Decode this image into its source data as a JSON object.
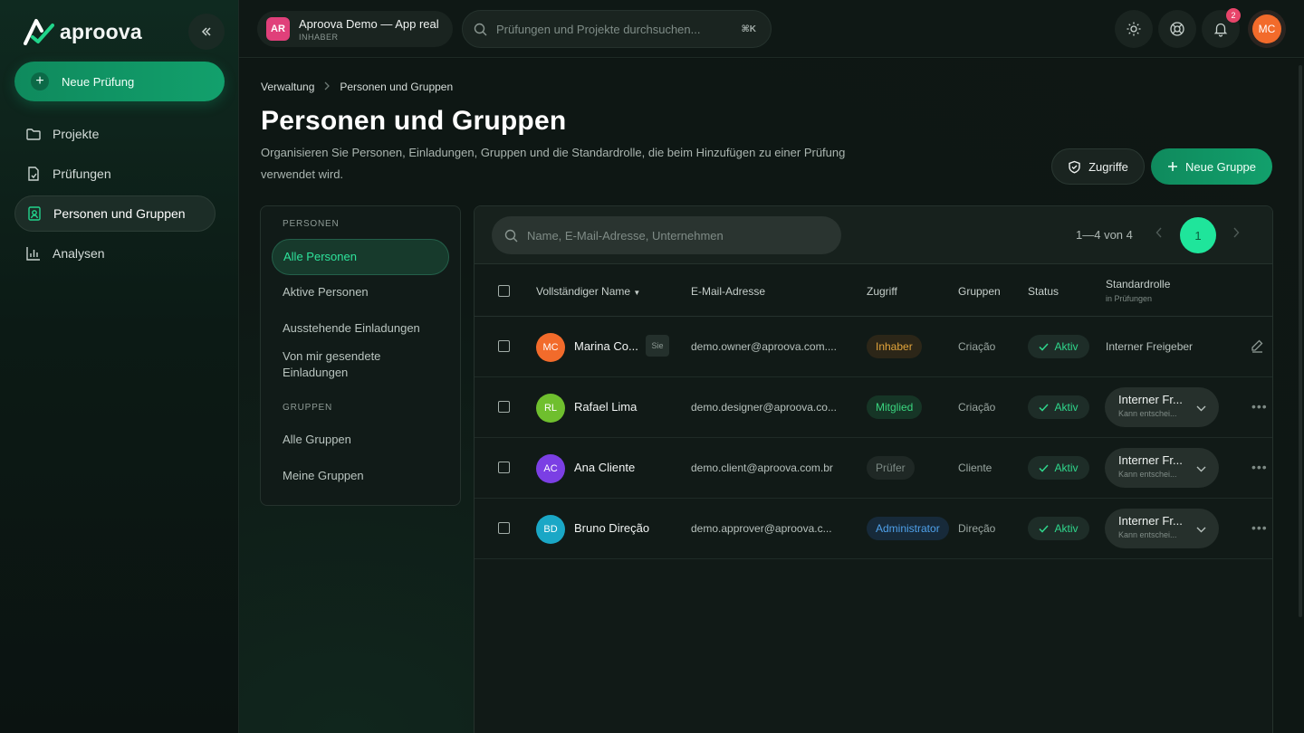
{
  "colors": {
    "accent": "#1fe59b",
    "brand_green": "#12a06c",
    "owner": "#e2a43b",
    "admin": "#4fa1ea"
  },
  "sidebar": {
    "brand": "aproova",
    "collapse_icon": "chevrons-left-icon",
    "new_exam_label": "Neue Prüfung",
    "items": [
      {
        "label": "Projekte",
        "icon": "folder-icon",
        "active": false
      },
      {
        "label": "Prüfungen",
        "icon": "file-check-icon",
        "active": false
      },
      {
        "label": "Personen und Gruppen",
        "icon": "contact-card-icon",
        "active": true
      },
      {
        "label": "Analysen",
        "icon": "bar-chart-icon",
        "active": false
      }
    ]
  },
  "topbar": {
    "workspace_initials": "AR",
    "workspace_name": "Aproova Demo — App real",
    "workspace_role": "INHABER",
    "search_placeholder": "Prüfungen und Projekte durchsuchen...",
    "search_shortcut": "⌘K",
    "notification_count": "2",
    "user_initials": "MC"
  },
  "page": {
    "breadcrumb": [
      "Verwaltung",
      "Personen und Gruppen"
    ],
    "title": "Personen und Gruppen",
    "description": "Organisieren Sie Personen, Einladungen, Gruppen und die Standardrolle, die beim Hinzufügen zu einer Prüfung verwendet wird.",
    "access_button": "Zugriffe",
    "new_group_button": "Neue Gruppe"
  },
  "filters": {
    "people_section": "PERSONEN",
    "people": [
      "Alle Personen",
      "Aktive Personen",
      "Ausstehende Einladungen",
      "Von mir gesendete Einladungen"
    ],
    "groups_section": "GRUPPEN",
    "groups": [
      "Alle Gruppen",
      "Meine Gruppen"
    ]
  },
  "table": {
    "search_placeholder": "Name, E-Mail-Adresse, Unternehmen",
    "pager_text": "1—4 von 4",
    "current_page": "1",
    "columns": {
      "name": "Vollständiger Name",
      "email": "E-Mail-Adresse",
      "access": "Zugriff",
      "groups": "Gruppen",
      "status": "Status",
      "role": "Standardrolle",
      "role_sub": "in Prüfungen"
    },
    "rows": [
      {
        "initials": "MC",
        "avatar_color": "#f26b2b",
        "name": "Marina Co...",
        "you": "Sie",
        "email": "demo.owner@aproova.com....",
        "access": "Inhaber",
        "access_type": "owner",
        "group": "Criação",
        "status": "Aktiv",
        "role": "Interner Freigeber",
        "role_sub": "",
        "editable": true
      },
      {
        "initials": "RL",
        "avatar_color": "#6fbf2e",
        "name": "Rafael Lima",
        "you": "",
        "email": "demo.designer@aproova.co...",
        "access": "Mitglied",
        "access_type": "member",
        "group": "Criação",
        "status": "Aktiv",
        "role": "Interner Fr...",
        "role_sub": "Kann entschei...",
        "editable": false
      },
      {
        "initials": "AC",
        "avatar_color": "#7b3fe4",
        "name": "Ana Cliente",
        "you": "",
        "email": "demo.client@aproova.com.br",
        "access": "Prüfer",
        "access_type": "reviewer",
        "group": "Cliente",
        "status": "Aktiv",
        "role": "Interner Fr...",
        "role_sub": "Kann entschei...",
        "editable": false
      },
      {
        "initials": "BD",
        "avatar_color": "#1aa7c6",
        "name": "Bruno Direção",
        "you": "",
        "email": "demo.approver@aproova.c...",
        "access": "Administrator",
        "access_type": "admin",
        "group": "Direção",
        "status": "Aktiv",
        "role": "Interner Fr...",
        "role_sub": "Kann entschei...",
        "editable": false
      }
    ]
  }
}
